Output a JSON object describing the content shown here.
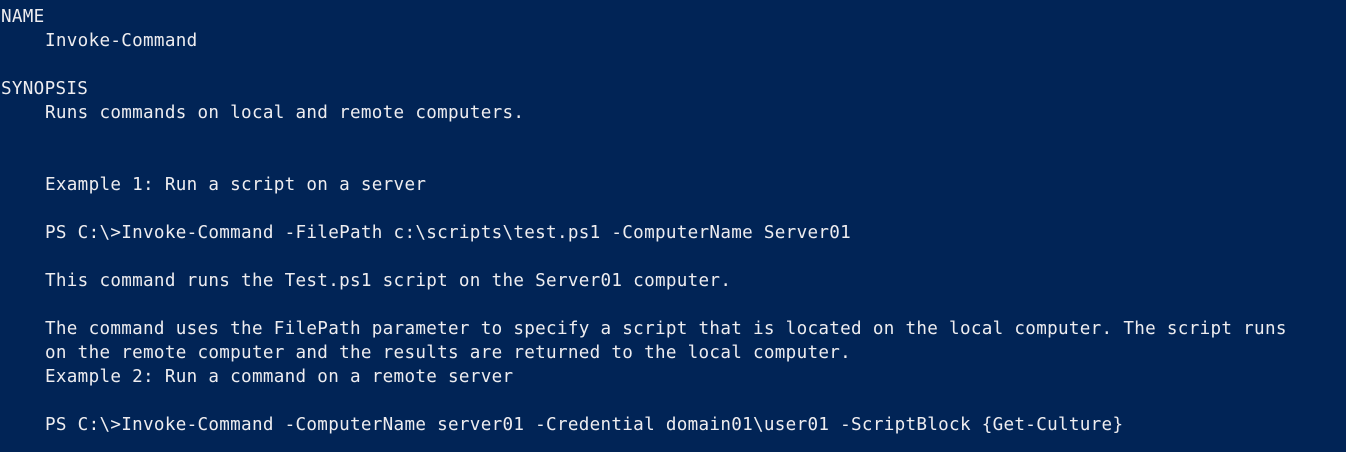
{
  "window": {
    "background": "#012456",
    "foreground": "#eeedf0"
  },
  "help": {
    "name_heading": "NAME",
    "name_value": "Invoke-Command",
    "synopsis_heading": "SYNOPSIS",
    "synopsis_value": "Runs commands on local and remote computers.",
    "example1": {
      "title": "Example 1: Run a script on a server",
      "command": "PS C:\\>Invoke-Command -FilePath c:\\scripts\\test.ps1 -ComputerName Server01",
      "desc1": "This command runs the Test.ps1 script on the Server01 computer.",
      "desc2_line1": "The command uses the FilePath parameter to specify a script that is located on the local computer. The script runs",
      "desc2_line2": "on the remote computer and the results are returned to the local computer."
    },
    "example2": {
      "title": "Example 2: Run a command on a remote server",
      "command": "PS C:\\>Invoke-Command -ComputerName server01 -Credential domain01\\user01 -ScriptBlock {Get-Culture}"
    }
  }
}
